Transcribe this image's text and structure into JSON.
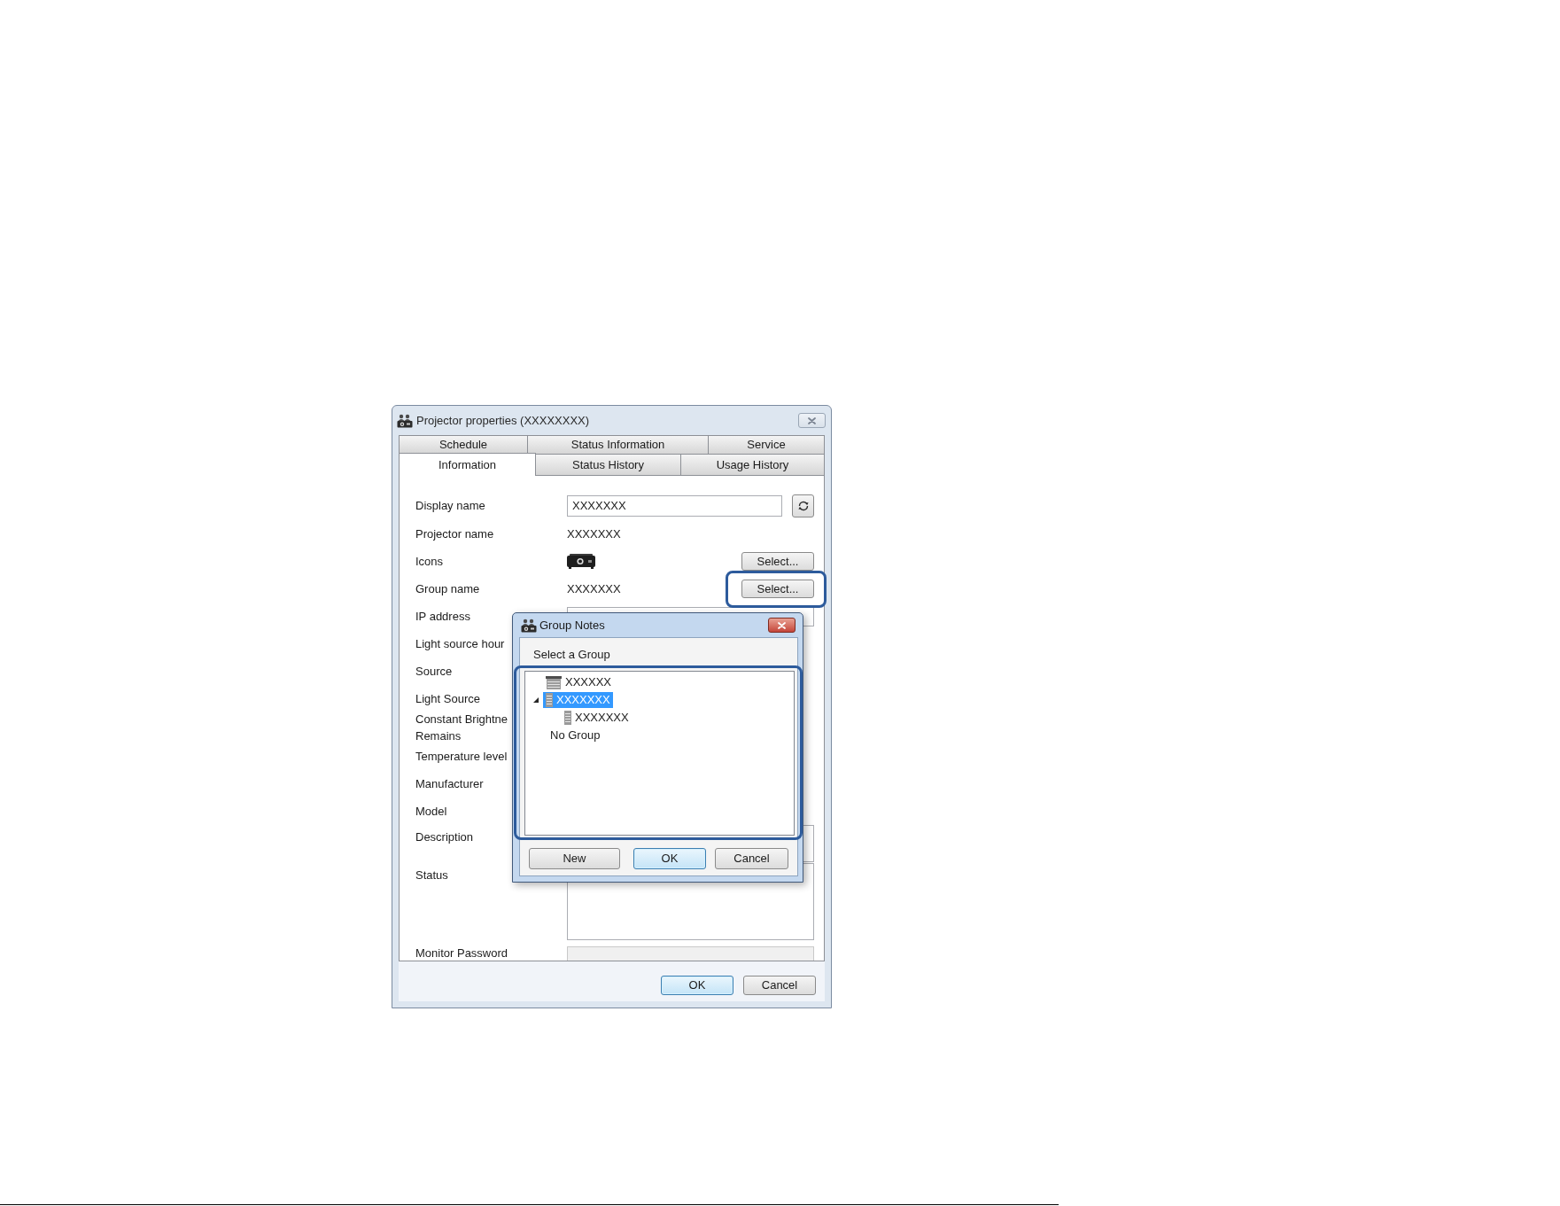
{
  "window": {
    "title": "Projector properties (XXXXXXXX)"
  },
  "tab_rows": [
    {
      "tabs": [
        {
          "label": "Schedule",
          "selected": false
        },
        {
          "label": "Status Information",
          "selected": false
        },
        {
          "label": "Service",
          "selected": false
        }
      ]
    },
    {
      "tabs": [
        {
          "label": "Information",
          "selected": true
        },
        {
          "label": "Status History",
          "selected": false
        },
        {
          "label": "Usage History",
          "selected": false
        }
      ]
    }
  ],
  "fields": [
    {
      "kind": "entry",
      "label": "Display name",
      "value": "XXXXXXX"
    },
    {
      "kind": "text",
      "label": "Projector name",
      "value": "XXXXXXX"
    },
    {
      "kind": "icon",
      "label": "Icons",
      "button": {
        "label": "Select...",
        "highlighted": false
      }
    },
    {
      "kind": "text",
      "label": "Group name",
      "value": "XXXXXXX",
      "button": {
        "label": "Select...",
        "highlighted": true
      }
    },
    {
      "kind": "input",
      "label": "IP address"
    },
    {
      "kind": "text",
      "label": "Light source hour"
    },
    {
      "kind": "text",
      "label": "Source"
    },
    {
      "kind": "text",
      "label": "Light Source"
    },
    {
      "kind": "wrapped",
      "lines": [
        "Constant Brightne",
        "Remains"
      ]
    },
    {
      "kind": "text",
      "label": "Temperature level"
    },
    {
      "kind": "text",
      "label": "Manufacturer"
    },
    {
      "kind": "text",
      "label": "Model"
    },
    {
      "kind": "box",
      "label": "Description"
    },
    {
      "kind": "textarea",
      "label": "Status"
    },
    {
      "kind": "password",
      "label": "Monitor Password",
      "disabled": true
    }
  ],
  "buttons": [
    {
      "label": "OK",
      "default": true
    },
    {
      "label": "Cancel",
      "default": false
    }
  ],
  "group_dialog": {
    "title": "Group Notes",
    "prompt": "Select a Group",
    "tree": {
      "highlighted": true,
      "items": [
        {
          "label": "XXXXXX",
          "kind": "rack",
          "selected": false
        },
        {
          "label": "XXXXXXX",
          "kind": "tower",
          "selected": true,
          "expanded": true,
          "children": [
            {
              "label": "XXXXXXX",
              "kind": "tower",
              "selected": false
            }
          ]
        },
        {
          "label": "No Group",
          "kind": "plain",
          "selected": false
        }
      ]
    },
    "buttons": [
      {
        "label": "New",
        "default": false
      },
      {
        "label": "OK",
        "default": true
      },
      {
        "label": "Cancel",
        "default": false
      }
    ]
  }
}
